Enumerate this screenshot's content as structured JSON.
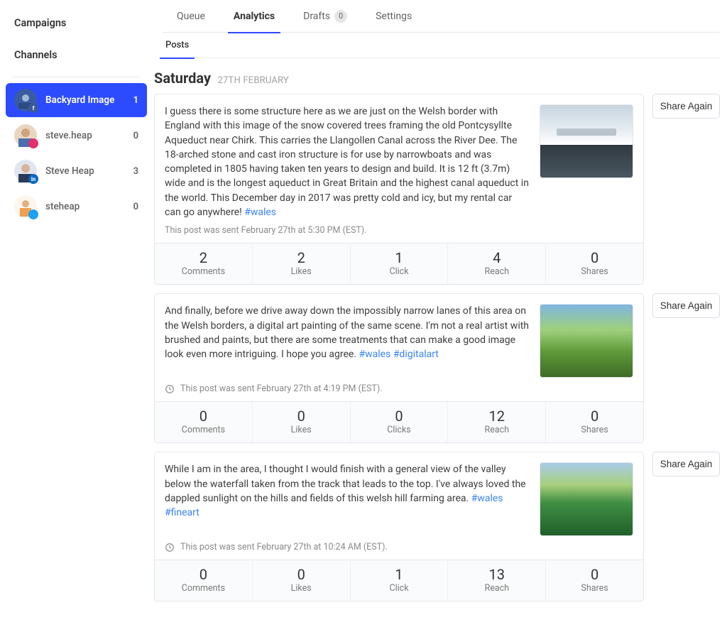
{
  "sidebar": {
    "campaigns_label": "Campaigns",
    "channels_label": "Channels",
    "channels": [
      {
        "name": "Backyard Image",
        "count": "1",
        "network": "facebook",
        "color": "#3b5998",
        "net_label": "f",
        "active": true
      },
      {
        "name": "steve.heap",
        "count": "0",
        "network": "instagram",
        "color": "#e1306c",
        "net_label": "",
        "active": false
      },
      {
        "name": "Steve Heap",
        "count": "3",
        "network": "linkedin",
        "color": "#0a66c2",
        "net_label": "in",
        "active": false
      },
      {
        "name": "steheap",
        "count": "0",
        "network": "twitter",
        "color": "#1da1f2",
        "net_label": "",
        "active": false
      }
    ]
  },
  "top_tabs": [
    {
      "label": "Queue",
      "active": false
    },
    {
      "label": "Analytics",
      "active": true
    },
    {
      "label": "Drafts",
      "badge": "0",
      "active": false
    },
    {
      "label": "Settings",
      "active": false
    }
  ],
  "sub_tabs": [
    {
      "label": "Posts",
      "active": true
    }
  ],
  "date_header": {
    "day": "Saturday",
    "date": "27TH FEBRUARY"
  },
  "share_again_label": "Share Again",
  "posts": [
    {
      "text": "I guess there is some structure here as we are just on the Welsh border with England with this image of the snow covered trees framing the old Pontcysyllte Aqueduct near Chirk. This carries the Llangollen Canal across the River Dee. The 18-arched stone and cast iron structure is for use by narrowboats and was completed in 1805 having taken ten years to design and build. It is 12 ft (3.7m) wide and is the longest aqueduct in Great Britain and the highest canal aqueduct in the world. This December day in 2017 was pretty cold and icy, but my rental car can go anywhere!",
      "hashtags": [
        "#wales"
      ],
      "sent_line": "This post was sent February 27th at 5:30 PM (EST).",
      "show_clock": false,
      "thumb": "snow",
      "stats": [
        {
          "value": "2",
          "label": "Comments"
        },
        {
          "value": "2",
          "label": "Likes"
        },
        {
          "value": "1",
          "label": "Click"
        },
        {
          "value": "4",
          "label": "Reach"
        },
        {
          "value": "0",
          "label": "Shares"
        }
      ]
    },
    {
      "text": "And finally, before we drive away down the impossibly narrow lanes of this area on the Welsh borders, a digital art painting of the same scene. I'm not a real artist with brushed and paints, but there are some treatments that can make a good image look even more intriguing. I hope you agree.",
      "hashtags": [
        "#wales",
        "#digitalart"
      ],
      "sent_line": "This post was sent February 27th at 4:19 PM (EST).",
      "show_clock": true,
      "thumb": "valley",
      "stats": [
        {
          "value": "0",
          "label": "Comments"
        },
        {
          "value": "0",
          "label": "Likes"
        },
        {
          "value": "0",
          "label": "Clicks"
        },
        {
          "value": "12",
          "label": "Reach"
        },
        {
          "value": "0",
          "label": "Shares"
        }
      ]
    },
    {
      "text": "While I am in the area, I thought I would finish with a general view of the valley below the waterfall taken from the track that leads to the top. I've always loved the dappled sunlight on the hills and fields of this welsh hill farming area.",
      "hashtags": [
        "#wales",
        "#fineart"
      ],
      "sent_line": "This post was sent February 27th at 10:24 AM (EST).",
      "show_clock": true,
      "thumb": "valley2",
      "stats": [
        {
          "value": "0",
          "label": "Comments"
        },
        {
          "value": "0",
          "label": "Likes"
        },
        {
          "value": "1",
          "label": "Click"
        },
        {
          "value": "13",
          "label": "Reach"
        },
        {
          "value": "0",
          "label": "Shares"
        }
      ]
    }
  ]
}
